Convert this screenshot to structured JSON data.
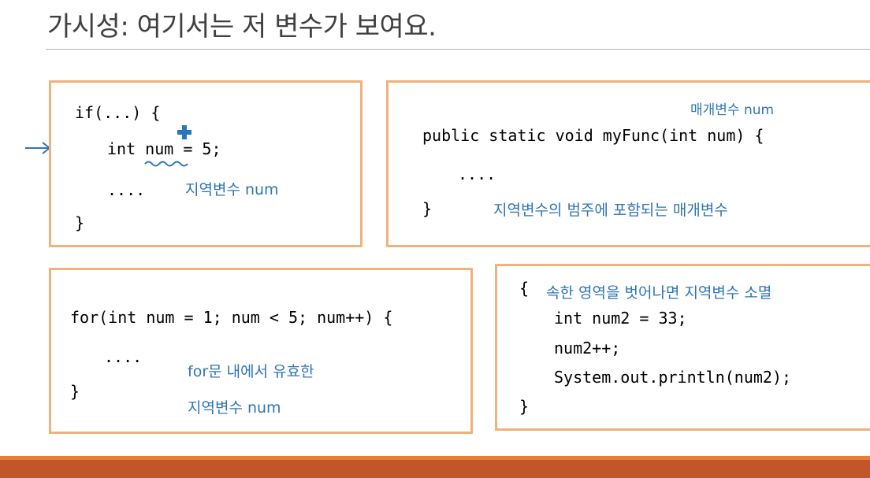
{
  "slide": {
    "title": "가시성: 여기서는 저 변수가 보여요."
  },
  "box1": {
    "line1": "if(...) {",
    "line2_prefix": "int ",
    "line2_var": "num",
    "line2_suffix": " = 5;",
    "line3": "....",
    "line4": "}",
    "note": "지역변수 num"
  },
  "box2": {
    "note_top": "매개변수 num",
    "line1": "public static void myFunc(int num) {",
    "line2": "....",
    "line3": "}",
    "note_bottom": "지역변수의 범주에 포함되는 매개변수"
  },
  "box3": {
    "line1": "for(int num = 1; num < 5; num++) {",
    "line2": "....",
    "line3": "}",
    "note_line1": "for문 내에서 유효한",
    "note_line2": "지역변수 num"
  },
  "box4": {
    "line1": "{",
    "note": "속한 영역을 벗어나면 지역변수 소멸",
    "line2": "int num2 = 33;",
    "line3": "num2++;",
    "line4": "System.out.println(num2);",
    "line5": "}"
  },
  "icons": {
    "pointer_arrow": "arrow-right-icon",
    "cursor": "move-cursor-icon",
    "squiggle": "error-squiggle-icon"
  },
  "colors": {
    "box_border": "#f0b27a",
    "note_blue": "#2e75b6",
    "band_orange": "#ed7d31",
    "band_rust": "#c0562a"
  }
}
